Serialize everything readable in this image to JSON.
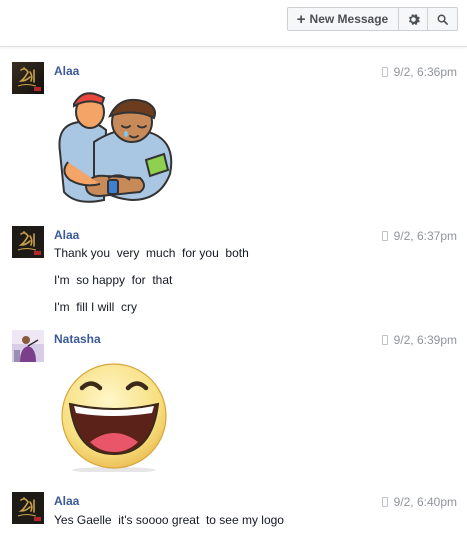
{
  "toolbar": {
    "new_message_label": "New Message",
    "plus_glyph": "+",
    "gear_icon": "gear-icon",
    "search_icon": "search-icon"
  },
  "messages": [
    {
      "sender": "Alaa",
      "timestamp": "9/2, 6:36pm",
      "content_type": "sticker",
      "sticker": "hug-sticker"
    },
    {
      "sender": "Alaa",
      "timestamp": "9/2, 6:37pm",
      "lines": [
        "Thank you  very  much  for you  both",
        "I'm  so happy  for  that",
        "I'm  fill I will  cry"
      ]
    },
    {
      "sender": "Natasha",
      "timestamp": "9/2, 6:39pm",
      "content_type": "sticker",
      "sticker": "laughing-smiley-sticker"
    },
    {
      "sender": "Alaa",
      "timestamp": "9/2, 6:40pm",
      "lines": [
        "Yes Gaelle  it's soooo great  to see my logo"
      ]
    }
  ],
  "colors": {
    "sender_name": "#3b5998",
    "timestamp": "#90949c",
    "text": "#141823"
  }
}
